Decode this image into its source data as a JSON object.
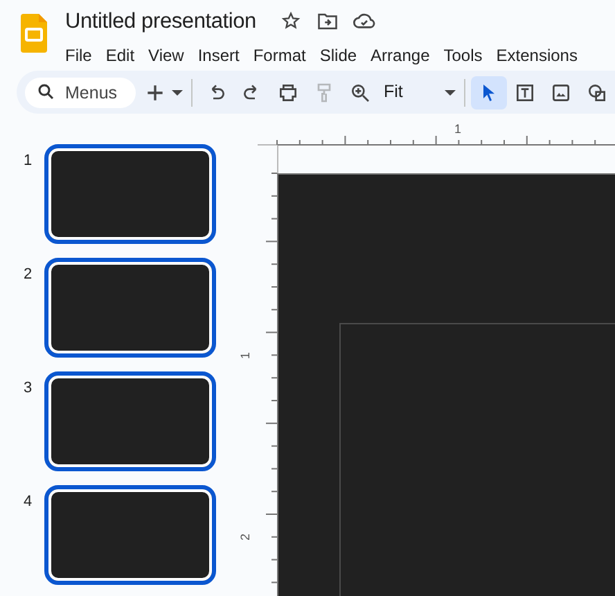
{
  "document": {
    "title": "Untitled presentation"
  },
  "menu": [
    "File",
    "Edit",
    "View",
    "Insert",
    "Format",
    "Slide",
    "Arrange",
    "Tools",
    "Extensions"
  ],
  "toolbar": {
    "search": {
      "placeholder": "Menus"
    },
    "zoom": "Fit",
    "tools": [
      {
        "kind": "add",
        "disabled": false,
        "selected": false
      },
      {
        "kind": "caret",
        "disabled": false,
        "selected": false
      },
      {
        "kind": "sep"
      },
      {
        "kind": "undo",
        "disabled": false,
        "selected": false
      },
      {
        "kind": "redo",
        "disabled": false,
        "selected": false
      },
      {
        "kind": "print",
        "disabled": false,
        "selected": false
      },
      {
        "kind": "paint",
        "disabled": true,
        "selected": false
      },
      {
        "kind": "zoom",
        "disabled": false,
        "selected": false
      },
      {
        "kind": "fit"
      },
      {
        "kind": "sep"
      },
      {
        "kind": "select",
        "disabled": false,
        "selected": true
      },
      {
        "kind": "textbox",
        "disabled": false,
        "selected": false
      },
      {
        "kind": "image",
        "disabled": false,
        "selected": false
      },
      {
        "kind": "shape",
        "disabled": false,
        "selected": false
      }
    ]
  },
  "slides": [
    {
      "number": "1",
      "selected": true
    },
    {
      "number": "2",
      "selected": true
    },
    {
      "number": "3",
      "selected": true
    },
    {
      "number": "4",
      "selected": true
    }
  ],
  "rulers": {
    "horizontal": [
      "1"
    ],
    "vertical": [
      "1",
      "2"
    ]
  }
}
